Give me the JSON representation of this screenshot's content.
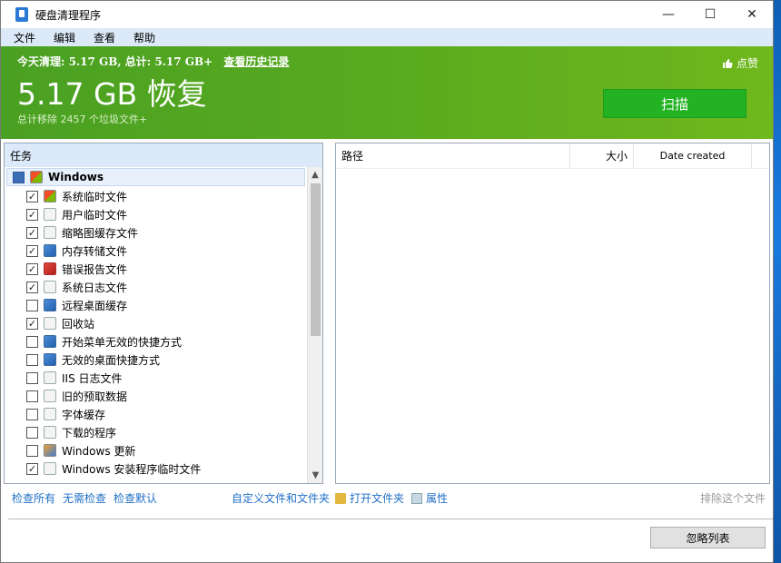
{
  "window": {
    "title": "硬盘清理程序",
    "controls": {
      "minimize": "—",
      "maximize": "☐",
      "close": "✕"
    }
  },
  "menu": [
    "文件",
    "编辑",
    "查看",
    "帮助"
  ],
  "banner": {
    "summary": "今天清理: 5.17 GB, 总计: 5.17 GB+",
    "history_link": "查看历史记录",
    "amount": "5.17 GB 恢复",
    "sub": "总计移除 2457 个垃圾文件+",
    "like": "点赞",
    "scan_button": "扫描"
  },
  "tasks": {
    "header": "任务",
    "group": "Windows",
    "items": [
      {
        "label": "系统临时文件",
        "checked": true,
        "icon": "win"
      },
      {
        "label": "用户临时文件",
        "checked": true,
        "icon": "plain"
      },
      {
        "label": "缩略图缓存文件",
        "checked": true,
        "icon": "plain"
      },
      {
        "label": "内存转储文件",
        "checked": true,
        "icon": "blue"
      },
      {
        "label": "错误报告文件",
        "checked": true,
        "icon": "red"
      },
      {
        "label": "系统日志文件",
        "checked": true,
        "icon": "plain"
      },
      {
        "label": "远程桌面缓存",
        "checked": false,
        "icon": "blue"
      },
      {
        "label": "回收站",
        "checked": true,
        "icon": "plain"
      },
      {
        "label": "开始菜单无效的快捷方式",
        "checked": false,
        "icon": "blue"
      },
      {
        "label": "无效的桌面快捷方式",
        "checked": false,
        "icon": "blue"
      },
      {
        "label": "IIS 日志文件",
        "checked": false,
        "icon": "plain"
      },
      {
        "label": "旧的预取数据",
        "checked": false,
        "icon": "plain"
      },
      {
        "label": "字体缓存",
        "checked": false,
        "icon": "plain"
      },
      {
        "label": "下载的程序",
        "checked": false,
        "icon": "plain"
      },
      {
        "label": "Windows 更新",
        "checked": false,
        "icon": "orange"
      },
      {
        "label": "Windows 安装程序临时文件",
        "checked": true,
        "icon": "plain"
      }
    ]
  },
  "files": {
    "columns": {
      "path": "路径",
      "size": "大小",
      "date": "Date created"
    }
  },
  "actions": {
    "check_all": "检查所有",
    "check_none": "无需检查",
    "check_default": "检查默认",
    "custom": "自定义文件和文件夹",
    "open_folder": "打开文件夹",
    "properties": "属性",
    "exclude": "排除这个文件"
  },
  "bottom": {
    "ignore_list": "忽略列表"
  }
}
